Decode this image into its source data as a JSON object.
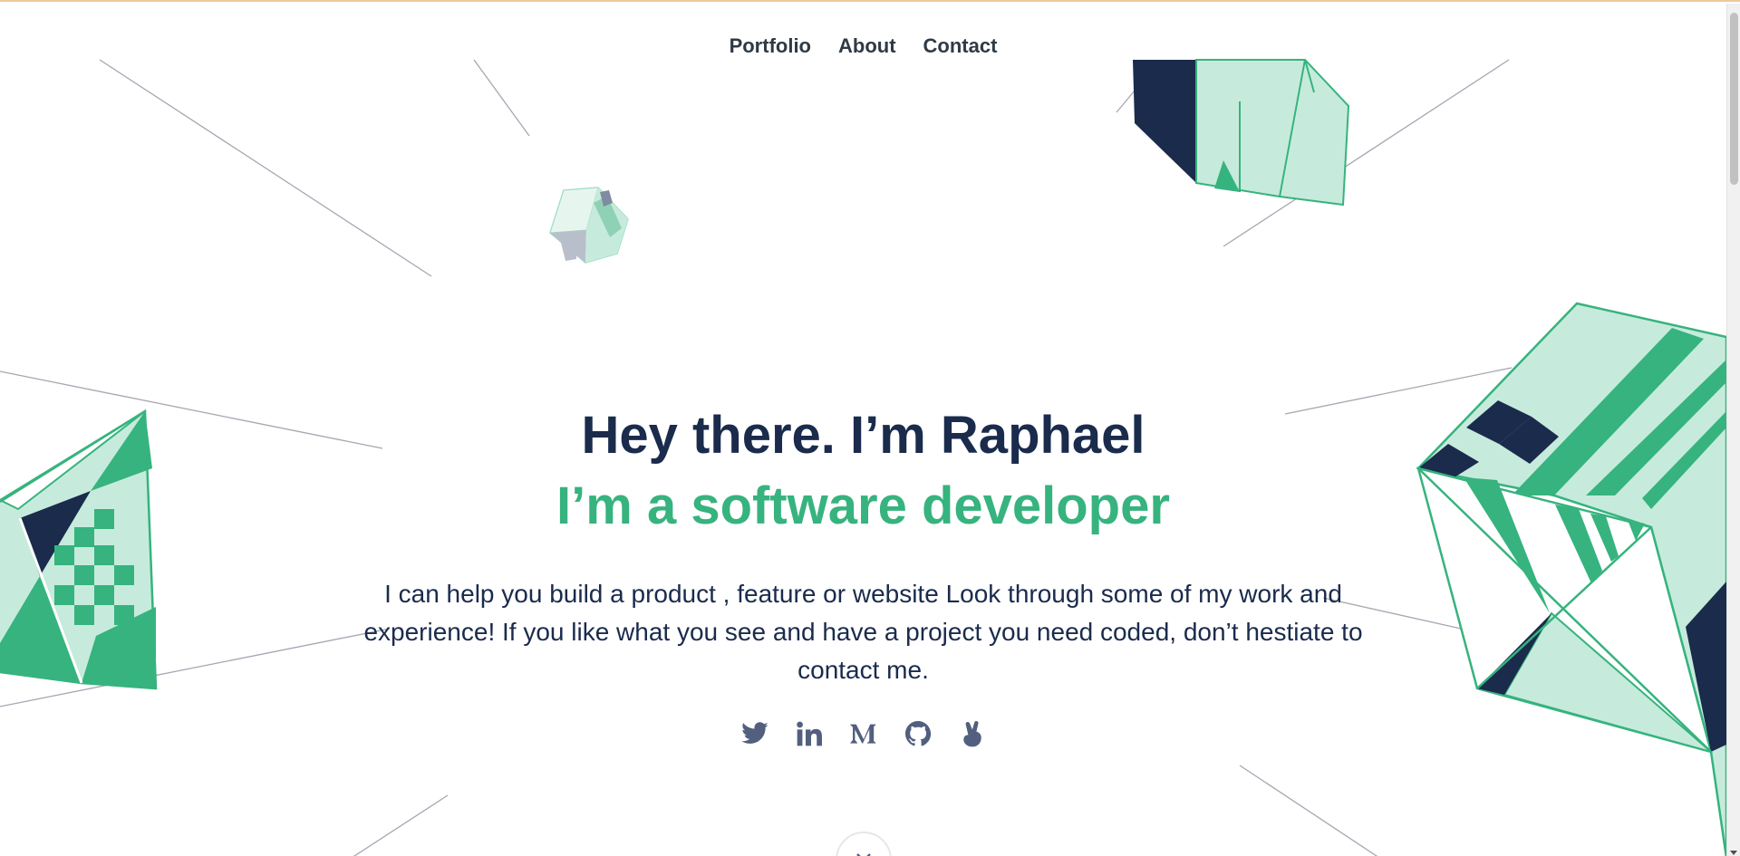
{
  "nav": {
    "items": [
      {
        "label": "Portfolio"
      },
      {
        "label": "About"
      },
      {
        "label": "Contact"
      }
    ]
  },
  "hero": {
    "title": "Hey there. I’m Raphael",
    "subtitle": "I’m a software developer",
    "description": "I can help you build a product , feature or website Look through some of my work and experience! If you like what you see and have a project you need coded, don’t hestiate to contact me."
  },
  "socials": [
    {
      "icon": "twitter-icon"
    },
    {
      "icon": "linkedin-icon"
    },
    {
      "icon": "medium-icon"
    },
    {
      "icon": "github-icon"
    },
    {
      "icon": "angellist-icon"
    }
  ],
  "colors": {
    "navy": "#1a2b4c",
    "green": "#36b37e",
    "mint": "#c6ebdc",
    "icon_gray": "#525f7f",
    "line_gray": "#a6a6b2"
  }
}
